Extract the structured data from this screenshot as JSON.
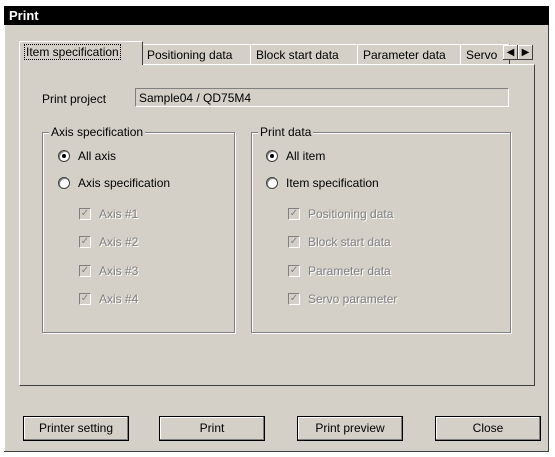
{
  "window": {
    "title": "Print"
  },
  "tabs": [
    {
      "label": "Item specification"
    },
    {
      "label": "Positioning data"
    },
    {
      "label": "Block start data"
    },
    {
      "label": "Parameter data"
    },
    {
      "label": "Servo"
    }
  ],
  "print_project": {
    "label": "Print project",
    "value": "Sample04 / QD75M4"
  },
  "axis_group": {
    "title": "Axis specification",
    "radios": [
      {
        "label": "All axis",
        "selected": true
      },
      {
        "label": "Axis specification",
        "selected": false
      }
    ],
    "checks": [
      {
        "label": "Axis #1",
        "checked": true
      },
      {
        "label": "Axis #2",
        "checked": true
      },
      {
        "label": "Axis #3",
        "checked": true
      },
      {
        "label": "Axis #4",
        "checked": true
      }
    ]
  },
  "data_group": {
    "title": "Print data",
    "radios": [
      {
        "label": "All item",
        "selected": true
      },
      {
        "label": "Item specification",
        "selected": false
      }
    ],
    "checks": [
      {
        "label": "Positioning data",
        "checked": true
      },
      {
        "label": "Block start data",
        "checked": true
      },
      {
        "label": "Parameter data",
        "checked": true
      },
      {
        "label": "Servo parameter",
        "checked": true
      }
    ]
  },
  "buttons": {
    "printer_setting": "Printer setting",
    "print": "Print",
    "print_preview": "Print preview",
    "close": "Close"
  }
}
